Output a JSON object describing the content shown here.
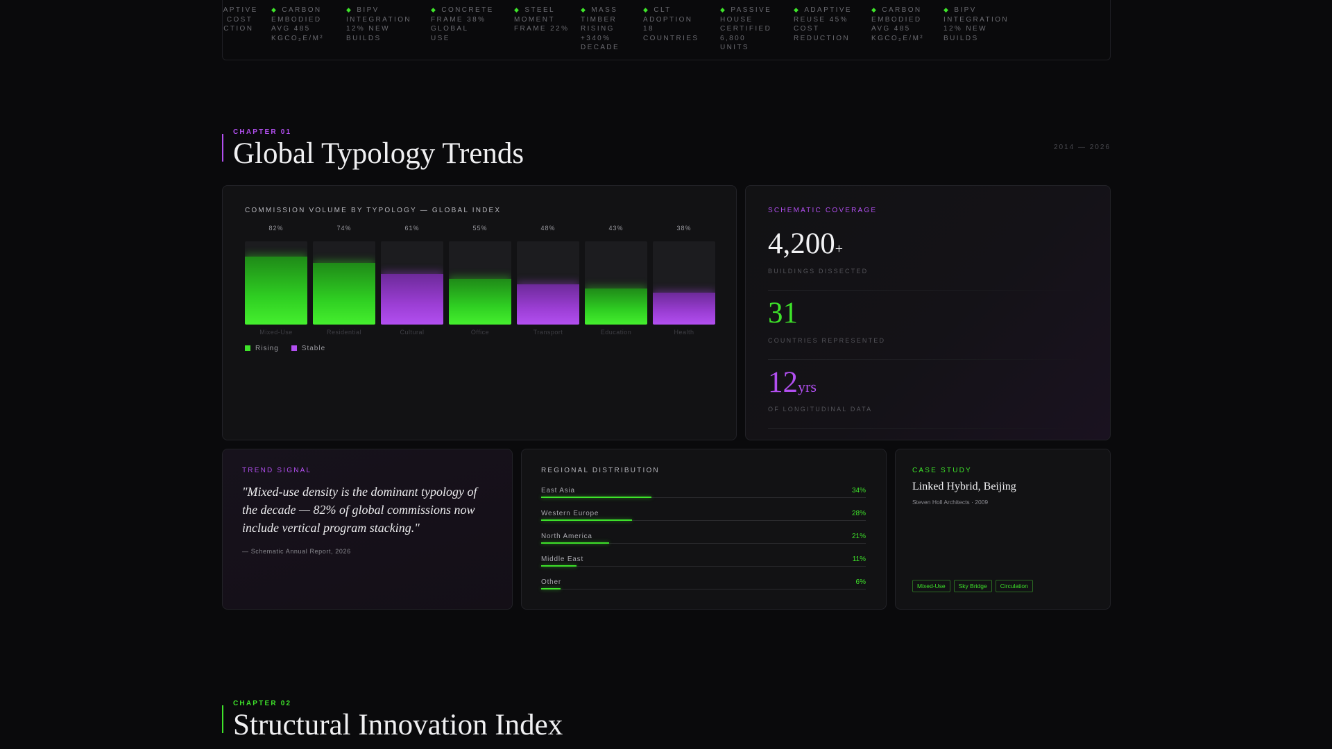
{
  "ticker": [
    "Adaptive Re Cost Duction",
    "Carbon Embodied Avg 485 KgCO₂e/m²",
    "BIPV Integration 12% New Builds",
    "Concrete Frame 38% Global Use",
    "Steel Moment Frame 22%",
    "Mass Timber Rising +340% Decade",
    "CLT Adoption 18 Countries",
    "Passive House Certified 6,800 Units",
    "Adaptive Reuse 45% Cost Reduction",
    "Carbon Embodied Avg 485 KgCO₂e/m²",
    "BIPV Integration 12% New Builds"
  ],
  "chapter1": {
    "label": "CHAPTER 01",
    "title": "Global Typology Trends",
    "range": "2014 — 2026"
  },
  "chart_card": {
    "title": "COMMISSION VOLUME BY TYPOLOGY — GLOBAL INDEX"
  },
  "chart_data": {
    "type": "bar",
    "categories": [
      "Mixed-Use",
      "Residential",
      "Cultural",
      "Office",
      "Transport",
      "Education",
      "Health"
    ],
    "values": [
      82,
      74,
      61,
      55,
      48,
      43,
      38
    ],
    "value_labels": [
      "82%",
      "74%",
      "61%",
      "55%",
      "48%",
      "43%",
      "38%"
    ],
    "series_status": [
      "Rising",
      "Rising",
      "Stable",
      "Rising",
      "Stable",
      "Rising",
      "Stable"
    ],
    "legend": [
      {
        "label": "Rising",
        "color": "#3ee32a"
      },
      {
        "label": "Stable",
        "color": "#b24ff0"
      }
    ],
    "title": "COMMISSION VOLUME BY TYPOLOGY — GLOBAL INDEX",
    "xlabel": "",
    "ylabel": "",
    "ylim": [
      0,
      100
    ]
  },
  "stats": {
    "title": "SCHEMATIC COVERAGE",
    "items": [
      {
        "value": "4,200",
        "suffix": "+",
        "label": "BUILDINGS DISSECTED",
        "color": "#f2f2f4"
      },
      {
        "value": "31",
        "suffix": "",
        "label": "COUNTRIES REPRESENTED",
        "color": "#3ee32a"
      },
      {
        "value": "12",
        "suffix": "yrs",
        "label": "OF LONGITUDINAL DATA",
        "color": "#b24ff0"
      }
    ]
  },
  "trend": {
    "title": "TREND SIGNAL",
    "quote": "\"Mixed-use density is the dominant typology of the decade — 82% of global commissions now include vertical program stacking.\"",
    "source": "— Schematic Annual Report, 2026"
  },
  "regional": {
    "title": "REGIONAL DISTRIBUTION",
    "items": [
      {
        "name": "East Asia",
        "pct": "34%",
        "value": 34
      },
      {
        "name": "Western Europe",
        "pct": "28%",
        "value": 28
      },
      {
        "name": "North America",
        "pct": "21%",
        "value": 21
      },
      {
        "name": "Middle East",
        "pct": "11%",
        "value": 11
      },
      {
        "name": "Other",
        "pct": "6%",
        "value": 6
      }
    ]
  },
  "case_study": {
    "title": "CASE STUDY",
    "name": "Linked Hybrid, Beijing",
    "meta": "Steven Holl Architects · 2009",
    "tags": [
      "Mixed-Use",
      "Sky Bridge",
      "Circulation"
    ]
  },
  "chapter2": {
    "label": "CHAPTER 02",
    "title": "Structural Innovation Index"
  },
  "colors": {
    "accent_green": "#3ee32a",
    "accent_purple": "#b24ff0",
    "background": "#0a0a0c"
  }
}
